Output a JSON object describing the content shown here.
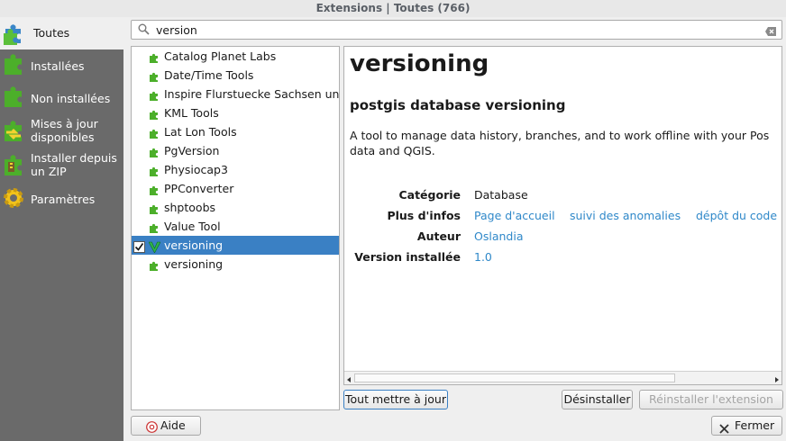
{
  "window": {
    "title": "Extensions | Toutes (766)"
  },
  "sidebar": {
    "items": [
      {
        "label": "Toutes",
        "icon": "puzzle-all-icon"
      },
      {
        "label": "Installées",
        "icon": "puzzle-installed-icon"
      },
      {
        "label": "Non installées",
        "icon": "puzzle-not-installed-icon"
      },
      {
        "label": "Mises à jour disponibles",
        "icon": "puzzle-update-icon"
      },
      {
        "label": "Installer depuis un ZIP",
        "icon": "puzzle-zip-icon"
      },
      {
        "label": "Paramètres",
        "icon": "gear-icon"
      }
    ]
  },
  "search": {
    "value": "version",
    "placeholder": ""
  },
  "plugins": [
    {
      "name": "Catalog Planet Labs",
      "checked": false,
      "selected": false
    },
    {
      "name": "Date/Time Tools",
      "checked": false,
      "selected": false
    },
    {
      "name": "Inspire Flurstuecke Sachsen und",
      "checked": false,
      "selected": false
    },
    {
      "name": "KML Tools",
      "checked": false,
      "selected": false
    },
    {
      "name": "Lat Lon Tools",
      "checked": false,
      "selected": false
    },
    {
      "name": "PgVersion",
      "checked": false,
      "selected": false
    },
    {
      "name": "Physiocap3",
      "checked": false,
      "selected": false
    },
    {
      "name": "PPConverter",
      "checked": false,
      "selected": false
    },
    {
      "name": "shptoobs",
      "checked": false,
      "selected": false
    },
    {
      "name": "Value Tool",
      "checked": false,
      "selected": false
    },
    {
      "name": "versioning",
      "checked": true,
      "selected": true
    },
    {
      "name": "versioning",
      "checked": false,
      "selected": false
    }
  ],
  "detail": {
    "title": "versioning",
    "subtitle": "postgis database versioning",
    "description_line1": "A tool to manage data history, branches, and to work offline with your Pos",
    "description_line2": "data and QGIS.",
    "category_label": "Catégorie",
    "category_value": "Database",
    "more_info_label": "Plus d'infos",
    "homepage_link": "Page d'accueil",
    "tracker_link": "suivi des anomalies",
    "repo_link": "dépôt du code",
    "author_label": "Auteur",
    "author_value": "Oslandia",
    "installed_version_label": "Version installée",
    "installed_version_value": "1.0"
  },
  "buttons": {
    "upgrade_all": "Tout mettre à jour",
    "uninstall": "Désinstaller",
    "reinstall": "Réinstaller l'extension",
    "help": "Aide",
    "close": "Fermer"
  },
  "colors": {
    "sidebar_bg": "#6a6a6a",
    "selection": "#3a80c4",
    "link": "#2f88c9",
    "plugin_green": "#4caf2a"
  }
}
